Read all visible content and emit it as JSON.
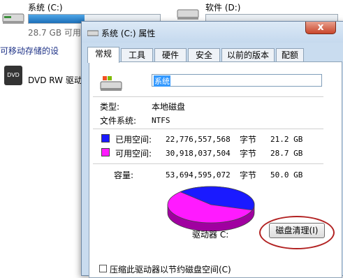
{
  "explorer": {
    "drive_c": {
      "name": "系统 (C:)",
      "free_text": "28.7 GB 可用",
      "used_fraction": 0.424
    },
    "drive_d": {
      "name": "软件 (D:)"
    },
    "section_removable": "可移动存储的设",
    "dvd": {
      "label": "DVD RW 驱动",
      "icon_text": "DVD"
    }
  },
  "dialog": {
    "title": "系统 (C:) 属性",
    "close_label": "x",
    "tabs": [
      "常规",
      "工具",
      "硬件",
      "安全",
      "以前的版本",
      "配额"
    ],
    "active_tab": 0,
    "volume_name": "系统",
    "type_label": "类型:",
    "type_value": "本地磁盘",
    "fs_label": "文件系统:",
    "fs_value": "NTFS",
    "used": {
      "label": "已用空间:",
      "bytes": "22,776,557,568",
      "unit": "字节",
      "size": "21.2 GB",
      "color": "#1a1aff"
    },
    "free": {
      "label": "可用空间:",
      "bytes": "30,918,037,504",
      "unit": "字节",
      "size": "28.7 GB",
      "color": "#ff1aff"
    },
    "capacity": {
      "label": "容量:",
      "bytes": "53,694,595,072",
      "unit": "字节",
      "size": "50.0 GB"
    },
    "used_fraction": 0.424,
    "drive_label": "驱动器 C:",
    "cleanup_button": "磁盘清理(I)",
    "compress_checkbox": "压缩此驱动器以节约磁盘空间(C)"
  }
}
